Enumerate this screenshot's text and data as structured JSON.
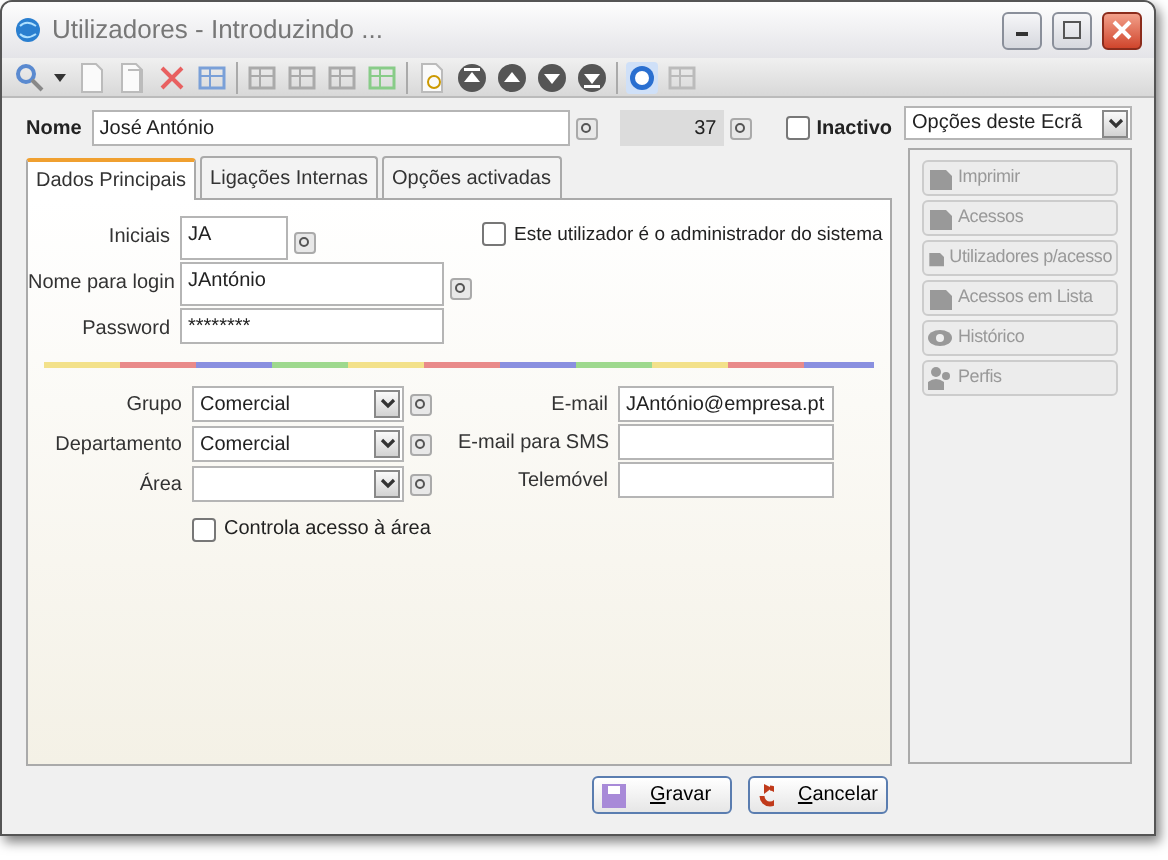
{
  "window": {
    "title": "Utilizadores - Introduzindo ..."
  },
  "header": {
    "name_label": "Nome",
    "name_value": "José António",
    "number": "37",
    "inactive": {
      "label": "Inactivo",
      "checked": false
    }
  },
  "tabs": [
    {
      "label": "Dados Principais",
      "selected": true
    },
    {
      "label": "Ligações Internas",
      "selected": false
    },
    {
      "label": "Opções activadas",
      "selected": false
    }
  ],
  "login_fields": [
    {
      "label": "Iniciais",
      "value": "JA",
      "kind": "short"
    },
    {
      "label": "Nome para login",
      "value": "JAntónio",
      "kind": "lookup"
    },
    {
      "label": "Password",
      "value": "********",
      "kind": "plain"
    }
  ],
  "admin": {
    "label": "Este utilizador é o administrador do sistema",
    "checked": false
  },
  "selects": [
    {
      "label": "Grupo",
      "value": "Comercial"
    },
    {
      "label": "Departamento",
      "value": "Comercial"
    },
    {
      "label": "Área"
    }
  ],
  "area_check": {
    "label": "Controla acesso à área",
    "checked": false
  },
  "contacts": [
    {
      "label": "E-mail",
      "value": "JAntónio@empresa.pt"
    },
    {
      "label": "E-mail para SMS"
    },
    {
      "label": "Telemóvel"
    }
  ],
  "buttons": [
    {
      "label": "Gravar",
      "kind": "save"
    },
    {
      "label": "Cancelar",
      "kind": "cancel"
    }
  ],
  "options": {
    "selector": "Opções deste Ecrã",
    "items": [
      {
        "label": "Imprimir",
        "disabled": true,
        "kind": "doc"
      },
      {
        "label": "Acessos",
        "disabled": true,
        "kind": "doc"
      },
      {
        "label": "Utilizadores p/acesso",
        "disabled": true,
        "kind": "doc"
      },
      {
        "label": "Acessos em Lista",
        "disabled": true,
        "kind": "doc"
      },
      {
        "label": "Histórico",
        "disabled": true,
        "kind": "eye"
      },
      {
        "label": "Perfis",
        "disabled": true,
        "kind": "people"
      }
    ]
  }
}
